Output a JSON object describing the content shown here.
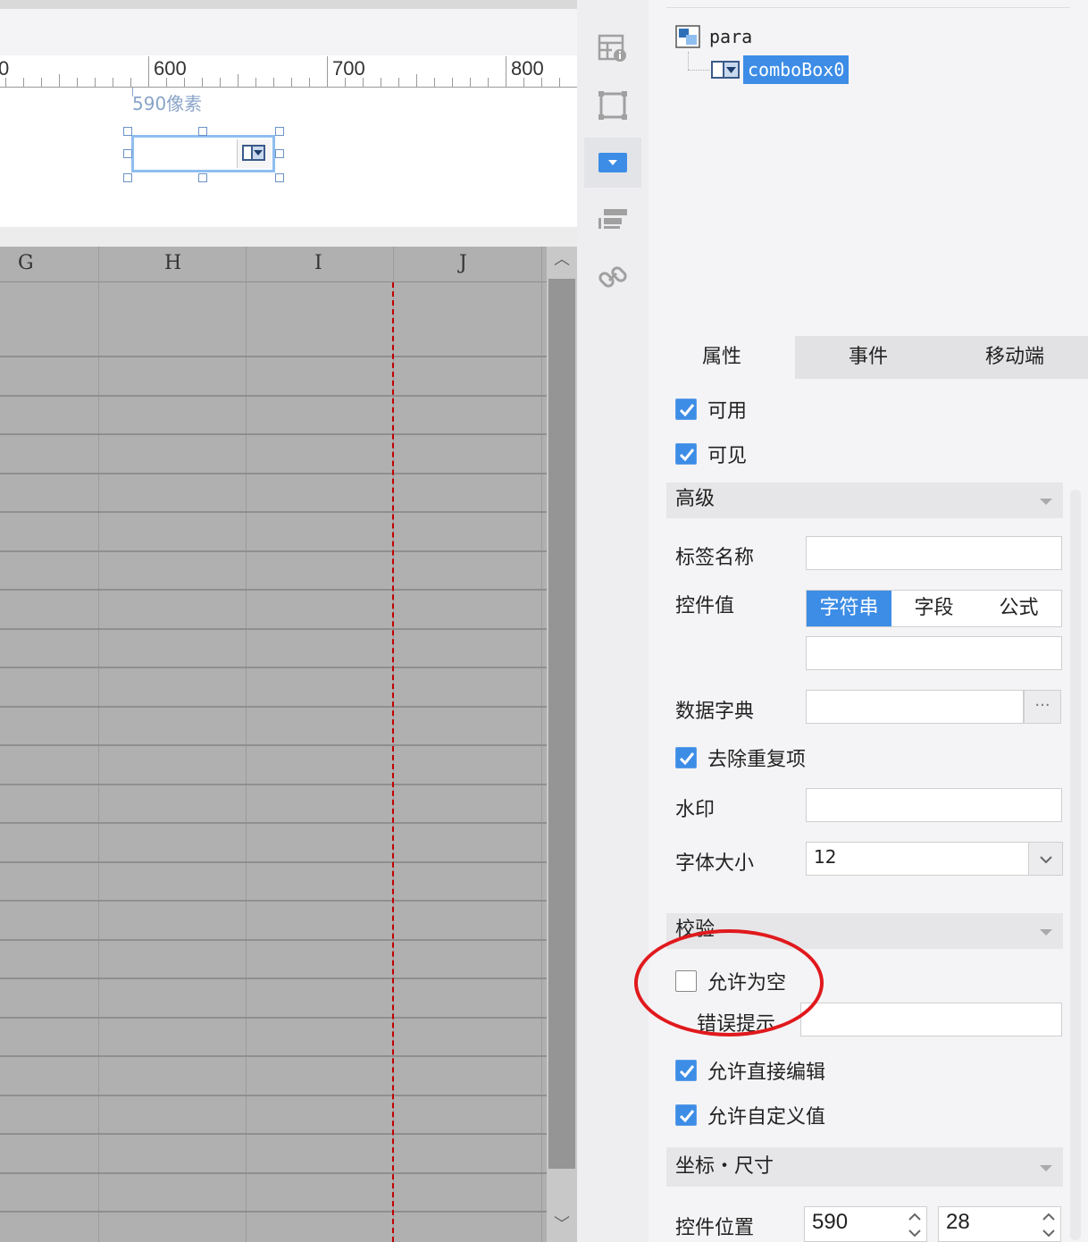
{
  "ruler": {
    "labels": [
      "0",
      "600",
      "700",
      "800"
    ]
  },
  "canvas": {
    "width_label": "590像素"
  },
  "grid": {
    "columns": [
      "G",
      "H",
      "I",
      "J"
    ]
  },
  "tree": {
    "root": "para",
    "child": "comboBox0"
  },
  "tabs": {
    "properties": "属性",
    "events": "事件",
    "mobile": "移动端"
  },
  "props": {
    "enabled": {
      "label": "可用",
      "checked": true
    },
    "visible": {
      "label": "可见",
      "checked": true
    },
    "advanced_section": "高级",
    "tag_name_label": "标签名称",
    "tag_name_value": "",
    "control_value_label": "控件值",
    "control_value_modes": [
      "字符串",
      "字段",
      "公式"
    ],
    "control_value_selected": "字符串",
    "control_value_text": "",
    "data_dict_label": "数据字典",
    "data_dict_value": "",
    "data_dict_button": "···",
    "remove_duplicates": {
      "label": "去除重复项",
      "checked": true
    },
    "watermark_label": "水印",
    "watermark_value": "",
    "font_size_label": "字体大小",
    "font_size_value": "12",
    "validation_section": "校验",
    "allow_empty": {
      "label": "允许为空",
      "checked": false
    },
    "error_hint_label": "错误提示",
    "error_hint_value": "",
    "allow_direct_edit": {
      "label": "允许直接编辑",
      "checked": true
    },
    "allow_custom_value": {
      "label": "允许自定义值",
      "checked": true
    },
    "coord_section": "坐标・尺寸",
    "position_label": "控件位置",
    "position_x": "590",
    "position_y": "28"
  },
  "colors": {
    "accent": "#3d8de6",
    "annotation": "#e0191d",
    "guide_line": "#c00000"
  }
}
